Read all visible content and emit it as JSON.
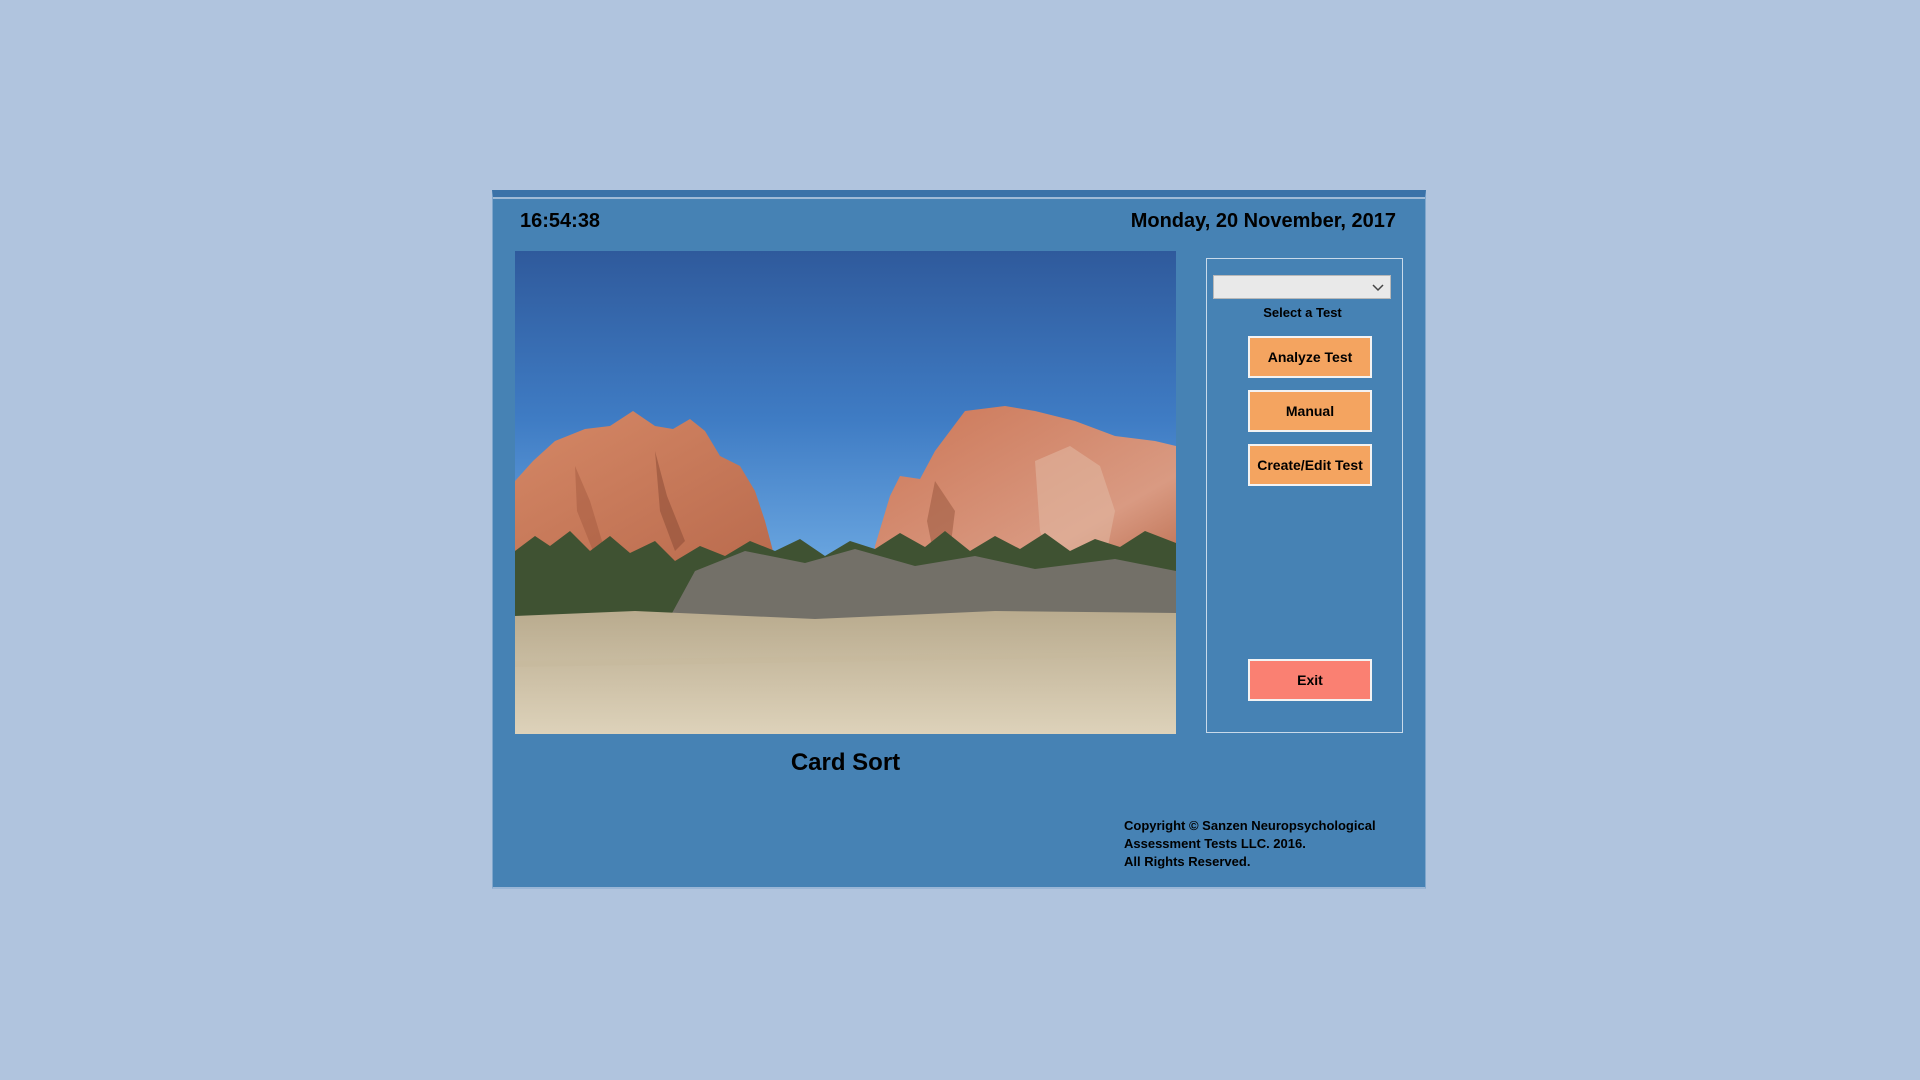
{
  "header": {
    "time": "16:54:38",
    "date": "Monday, 20 November, 2017"
  },
  "main": {
    "image_description": "landscape-photo",
    "app_title": "Card Sort"
  },
  "panel": {
    "select": {
      "value": "",
      "label": "Select a Test",
      "icon": "chevron-down-icon"
    },
    "buttons": {
      "analyze": "Analyze Test",
      "manual": "Manual",
      "create_edit": "Create/Edit Test",
      "exit": "Exit"
    }
  },
  "footer": {
    "copyright_lines": [
      "Copyright © Sanzen Neuropsychological",
      "Assessment Tests LLC. 2016.",
      "All Rights Reserved."
    ]
  },
  "colors": {
    "page_bg": "#b0c4de",
    "window_bg": "#4682b4",
    "button_orange": "#f4a460",
    "button_exit": "#fa8072"
  }
}
